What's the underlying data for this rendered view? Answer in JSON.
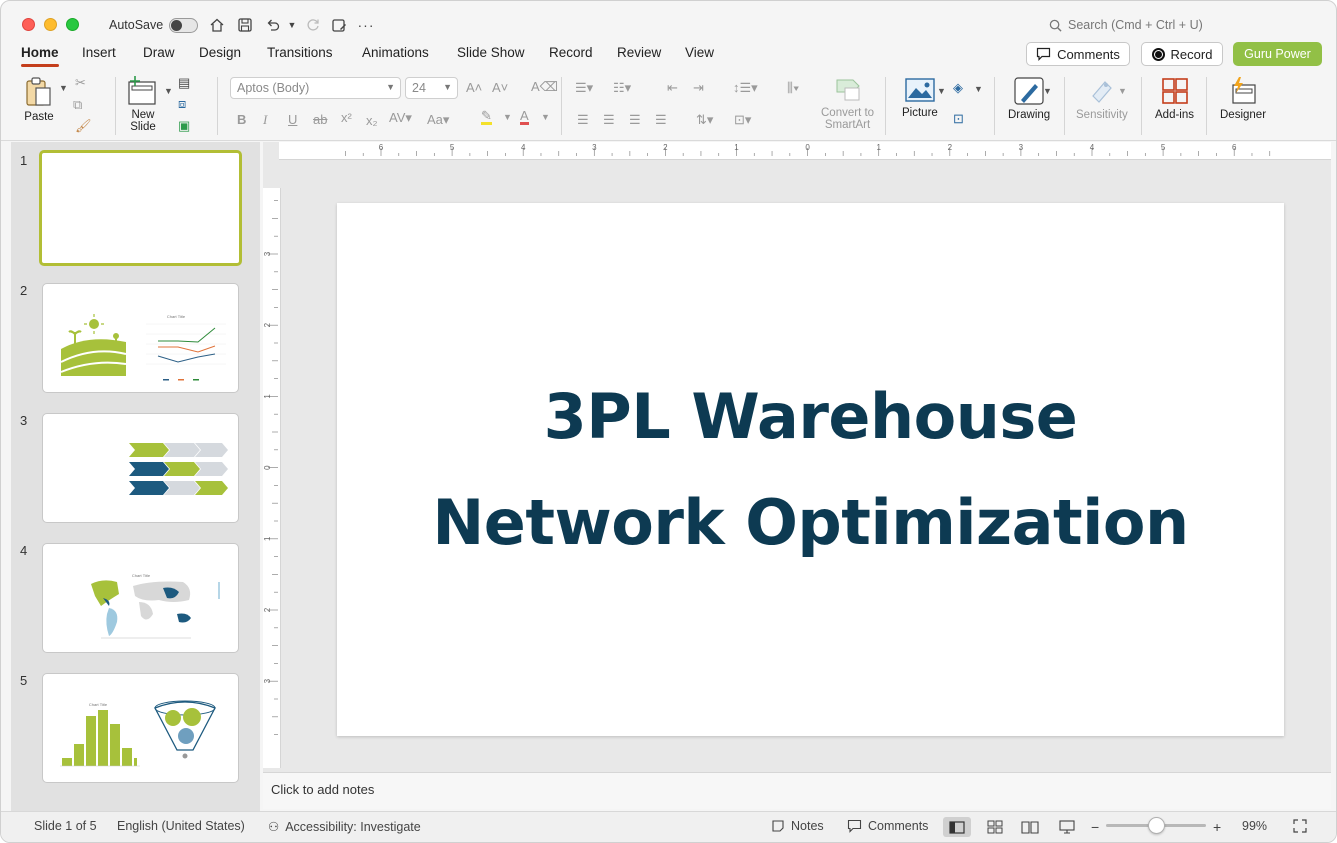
{
  "titlebar": {
    "autosave_label": "AutoSave",
    "search_placeholder": "Search (Cmd + Ctrl + U)"
  },
  "menu": {
    "tabs": [
      "Home",
      "Insert",
      "Draw",
      "Design",
      "Transitions",
      "Animations",
      "Slide Show",
      "Record",
      "Review",
      "View"
    ],
    "active_tab": "Home",
    "comments_label": "Comments",
    "record_label": "Record",
    "guru_label": "Guru Power"
  },
  "ribbon": {
    "paste": "Paste",
    "new_slide": "New\nSlide",
    "font_name": "Aptos (Body)",
    "font_size": "24",
    "convert_smartart": "Convert to\nSmartArt",
    "picture": "Picture",
    "drawing": "Drawing",
    "sensitivity": "Sensitivity",
    "addins": "Add-ins",
    "designer": "Designer"
  },
  "ruler": {
    "h_labels": [
      "6",
      "5",
      "4",
      "3",
      "2",
      "1",
      "0",
      "1",
      "2",
      "3",
      "4",
      "5",
      "6"
    ],
    "v_labels": [
      "3",
      "2",
      "1",
      "0",
      "1",
      "2",
      "3"
    ]
  },
  "thumbnails": {
    "numbers": [
      "1",
      "2",
      "3",
      "4",
      "5"
    ],
    "chart_title": "Chart Title"
  },
  "slide": {
    "title_line1": "3PL Warehouse",
    "title_line2": "Network Optimization"
  },
  "notes_placeholder": "Click to add notes",
  "status": {
    "slide_info": "Slide 1 of 5",
    "language": "English (United States)",
    "accessibility": "Accessibility: Investigate",
    "notes_label": "Notes",
    "comments_label": "Comments",
    "zoom": "99%"
  },
  "colors": {
    "accent_tab": "#c43e1c",
    "title_text": "#0d3a52",
    "green": "#92c046",
    "navy": "#1d5a7f"
  }
}
